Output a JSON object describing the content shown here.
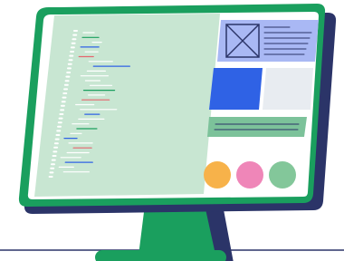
{
  "illustration": {
    "subject": "monitor-with-code-editor-and-layout-preview",
    "colors": {
      "frame": "#1a9f5e",
      "frame_shadow": "#2b3468",
      "screen_bg": "#ffffff",
      "editor_bg": "#c8e6d2",
      "code_white": "#ffffff",
      "code_green": "#1a9f5e",
      "code_blue": "#2f62e5",
      "code_red": "#e5676f",
      "panel_image": "#a9b8f4",
      "panel_blue": "#2f62e5",
      "panel_gray": "#e8ecf1",
      "panel_banner": "#7cc29a",
      "dot_orange": "#f7b24a",
      "dot_pink": "#ef86b8",
      "dot_green": "#83c79a",
      "stand": "#1a9f5e",
      "floor_line": "#2b3468"
    },
    "icons": [
      "image-placeholder-icon"
    ]
  }
}
